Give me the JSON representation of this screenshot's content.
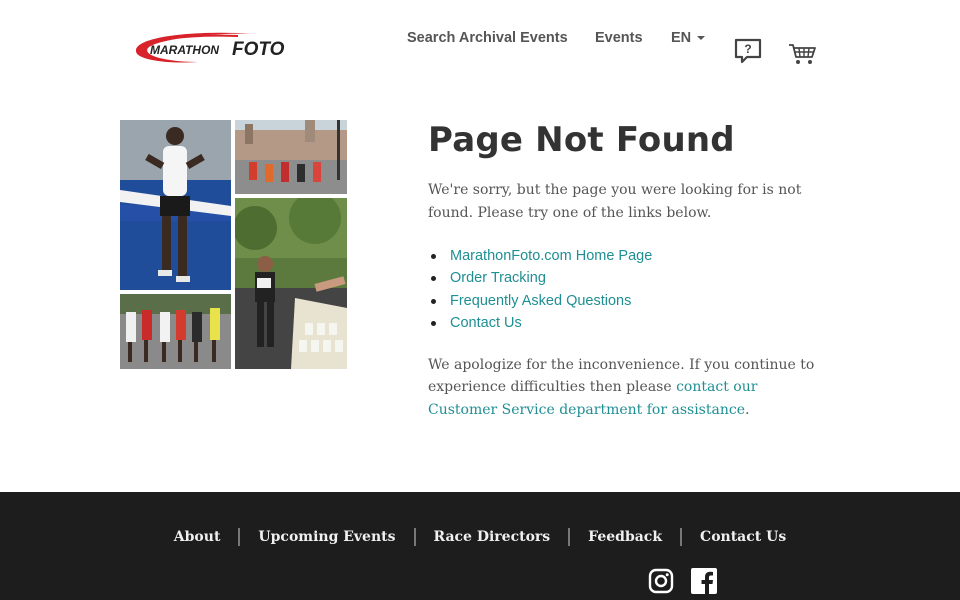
{
  "header": {
    "logo_text_a": "MARATHON",
    "logo_text_b": "FOTO",
    "nav": {
      "search_archival": "Search Archival Events",
      "events": "Events",
      "language": "EN"
    },
    "help_icon_text": "?"
  },
  "main": {
    "title": "Page Not Found",
    "intro": "We're sorry, but the page you were looking for is not found. Please try one of the links below.",
    "links": [
      {
        "label": "MarathonFoto.com Home Page"
      },
      {
        "label": "Order Tracking"
      },
      {
        "label": "Frequently Asked Questions"
      },
      {
        "label": "Contact Us"
      }
    ],
    "apology_text": "We apologize for the inconvenience. If you continue to experience difficulties then please ",
    "apology_link": "contact our Customer Service department for assistance",
    "apology_end": "."
  },
  "footer": {
    "links": [
      "About",
      "Upcoming Events",
      "Race Directors",
      "Feedback",
      "Contact Us"
    ],
    "social": [
      "instagram-icon",
      "facebook-icon"
    ]
  },
  "colors": {
    "link": "#1f8f93",
    "footer_bg": "#1d1d1d",
    "logo_red": "#d8232a"
  }
}
